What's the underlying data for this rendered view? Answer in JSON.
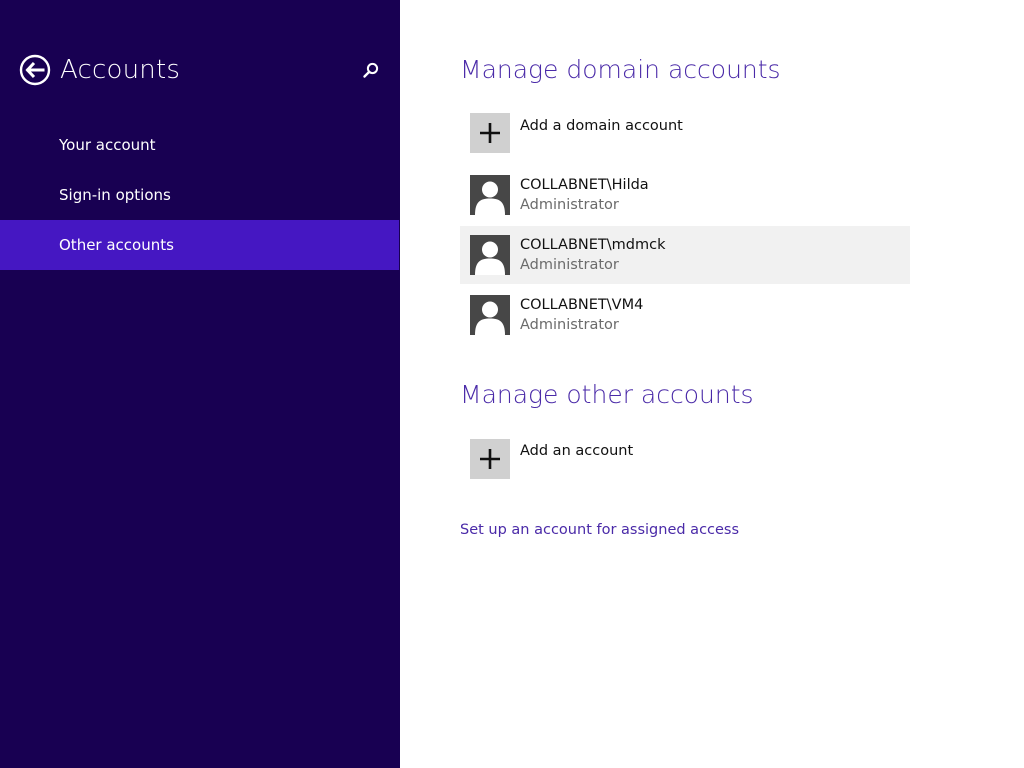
{
  "nav": {
    "title": "Accounts",
    "back_icon": "back-arrow-icon",
    "search_icon": "search-icon",
    "items": [
      {
        "label": "Your account",
        "selected": false
      },
      {
        "label": "Sign-in options",
        "selected": false
      },
      {
        "label": "Other accounts",
        "selected": true
      }
    ]
  },
  "domain_section": {
    "title": "Manage domain accounts",
    "add_label": "Add a domain account",
    "accounts": [
      {
        "name": "COLLABNET\\Hilda",
        "role": "Administrator"
      },
      {
        "name": "COLLABNET\\mdmck",
        "role": "Administrator"
      },
      {
        "name": "COLLABNET\\VM4",
        "role": "Administrator"
      }
    ]
  },
  "other_section": {
    "title": "Manage other accounts",
    "add_label": "Add an account"
  },
  "assigned_access_link": "Set up an account for assigned access",
  "colors": {
    "nav_background": "#180052",
    "nav_selected": "#4517c2",
    "accent_text": "#4a2aa8",
    "hover_row": "#f1f1f1"
  }
}
